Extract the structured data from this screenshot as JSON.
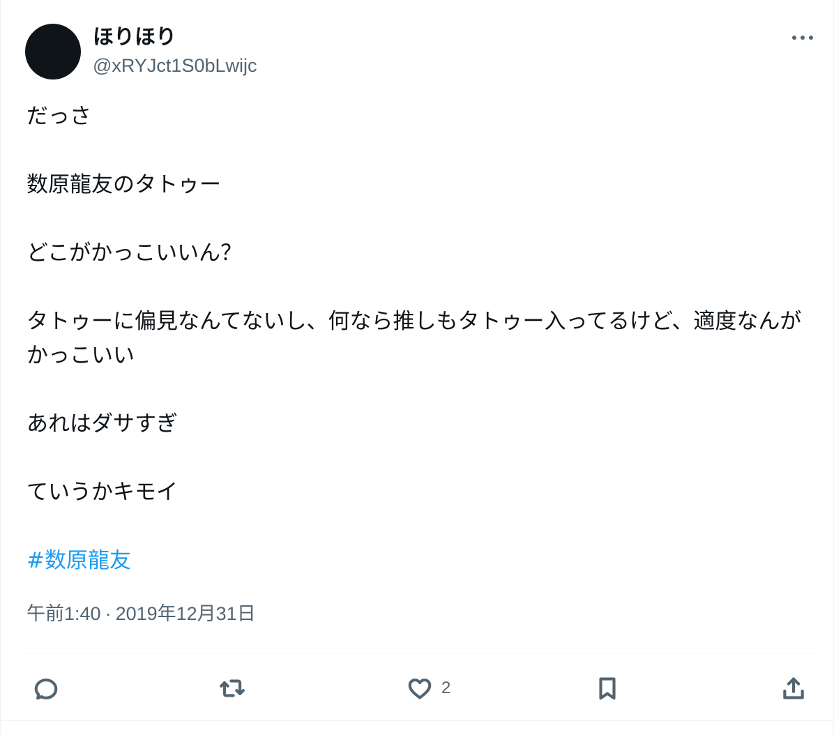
{
  "author": {
    "display_name": "ほりほり",
    "handle": "@xRYJct1S0bLwijc"
  },
  "tweet": {
    "paragraphs": [
      "だっさ",
      "数原龍友のタトゥー",
      "どこがかっこいいん？",
      "タトゥーに偏見なんてないし、何なら推しもタトゥー入ってるけど、適度なんがかっこいい",
      "あれはダサすぎ",
      "ていうかキモイ"
    ],
    "hashtag": "#数原龍友"
  },
  "meta": {
    "time": "午前1:40",
    "separator": "·",
    "date": "2019年12月31日"
  },
  "actions": {
    "reply_icon": "reply-icon",
    "retweet_icon": "retweet-icon",
    "like_icon": "heart-icon",
    "like_count": "2",
    "bookmark_icon": "bookmark-icon",
    "share_icon": "share-icon"
  },
  "colors": {
    "text": "#0f1419",
    "secondary": "#536471",
    "link": "#1d9bf0",
    "border": "#eff3f4"
  }
}
